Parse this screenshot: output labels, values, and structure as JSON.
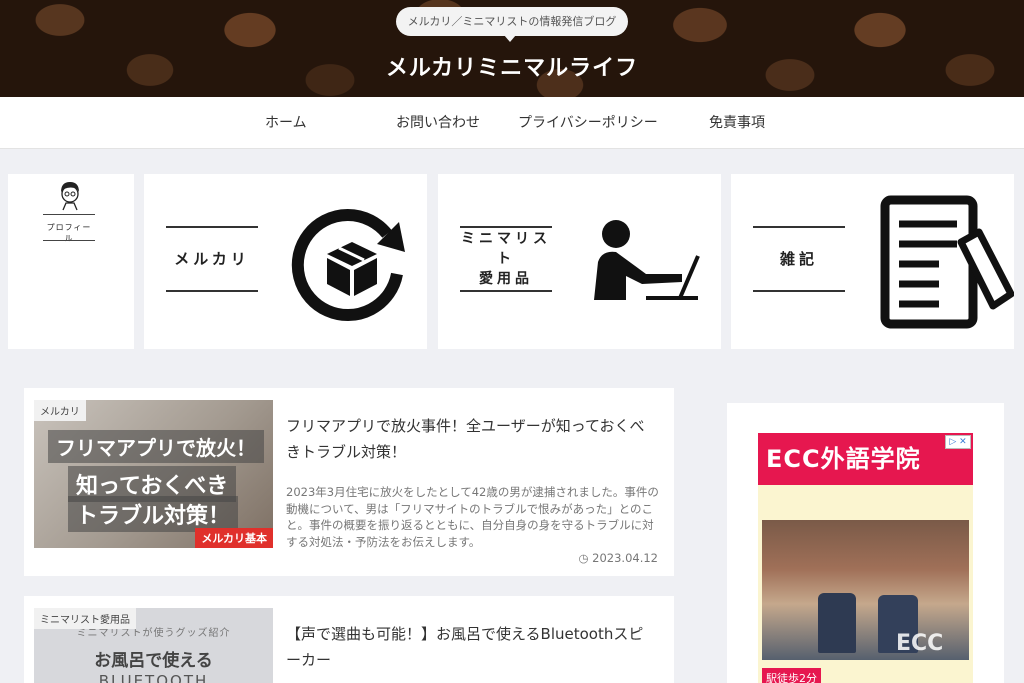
{
  "header": {
    "tagline": "メルカリ／ミニマリストの情報発信ブログ",
    "site_title": "メルカリミニマルライフ"
  },
  "nav": {
    "items": [
      {
        "label": "ホーム"
      },
      {
        "label": "お問い合わせ"
      },
      {
        "label": "プライバシーポリシー"
      },
      {
        "label": "免責事項"
      }
    ]
  },
  "cards": {
    "profile": {
      "label": "プロフィール"
    },
    "categories": [
      {
        "label": "メルカリ",
        "icon": "box-exchange-icon"
      },
      {
        "label": "ミニマリスト愛用品",
        "line1": "ミニマリスト",
        "line2": "愛用品",
        "icon": "person-laptop-icon"
      },
      {
        "label": "雑記",
        "icon": "document-pen-icon"
      }
    ]
  },
  "articles": [
    {
      "category": "メルカリ",
      "thumb_line1": "フリマアプリで放火！",
      "thumb_line2": "知っておくべき",
      "thumb_line3": "トラブル対策！",
      "thumb_badge": "メルカリ基本",
      "title": "フリマアプリで放火事件！全ユーザーが知っておくべきトラブル対策！",
      "excerpt": "2023年3月住宅に放火をしたとして42歳の男が逮捕されました。事件の動機について、男は「フリマサイトのトラブルで恨みがあった」とのこと。事件の概要を振り返るとともに、自分自身の身を守るトラブルに対する対処法・予防法をお伝えします。",
      "date": "2023.04.12"
    },
    {
      "category": "ミニマリスト愛用品",
      "thumb_sub": "ミニマリストが使うグッズ紹介",
      "thumb_main": "お風呂で使える",
      "thumb_bt": "BLUETOOTH",
      "title": "【声で選曲も可能！】お風呂で使えるBluetoothスピーカー"
    }
  ],
  "ad": {
    "headline": "ECC外語学院",
    "logo": "ECC",
    "footer": "駅徒歩2分",
    "close": "▷ ✕"
  },
  "colors": {
    "ad_accent": "#e6174f",
    "badge_red": "#e0302b",
    "page_bg": "#eff0f4"
  }
}
